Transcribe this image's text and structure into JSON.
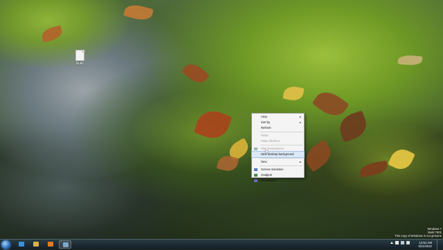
{
  "desktop": {
    "icons": [
      {
        "label": "Nuiki",
        "icon": "text-file-icon"
      }
    ]
  },
  "context_menu": {
    "items": [
      {
        "label": "View",
        "submenu": true,
        "disabled": false
      },
      {
        "label": "Sort by",
        "submenu": true,
        "disabled": false
      },
      {
        "label": "Refresh",
        "submenu": false,
        "disabled": false
      },
      {
        "sep": true
      },
      {
        "label": "Paste",
        "submenu": false,
        "disabled": true
      },
      {
        "label": "Paste shortcut",
        "submenu": false,
        "disabled": true
      },
      {
        "sep": true
      },
      {
        "label": "Play Dreamscene",
        "submenu": false,
        "disabled": true,
        "icon": "dreamscene-icon"
      },
      {
        "label": "Next desktop background",
        "submenu": false,
        "disabled": false,
        "hover": true
      },
      {
        "sep": true
      },
      {
        "label": "New",
        "submenu": true,
        "disabled": false
      },
      {
        "sep": true
      },
      {
        "label": "Screen resolution",
        "submenu": false,
        "disabled": false,
        "icon": "screen-resolution-icon"
      },
      {
        "label": "Gadgets",
        "submenu": false,
        "disabled": false,
        "icon": "gadgets-icon"
      },
      {
        "label": "Personalize",
        "submenu": false,
        "disabled": false,
        "icon": "personalize-icon"
      }
    ]
  },
  "watermark": {
    "line1": "Windows 7",
    "line2": "Build 7601",
    "line3": "This copy of Windows is not genuine"
  },
  "taskbar": {
    "start_icon": "windows-start-icon",
    "pinned": [
      {
        "name": "internet-explorer-icon",
        "color": "#3a8fdc"
      },
      {
        "name": "windows-explorer-icon",
        "color": "#d9b14a"
      },
      {
        "name": "media-player-icon",
        "color": "#e07a20"
      },
      {
        "name": "desktop-background-window-icon",
        "color": "#7fa6c9",
        "active": true
      }
    ],
    "clock": {
      "time": "12:51 AM",
      "date": "5/21/2012"
    }
  },
  "colors": {
    "menu_bg": "#f4f4f4",
    "menu_hover": "#dbe8f6",
    "taskbar": "#1c2b35"
  }
}
